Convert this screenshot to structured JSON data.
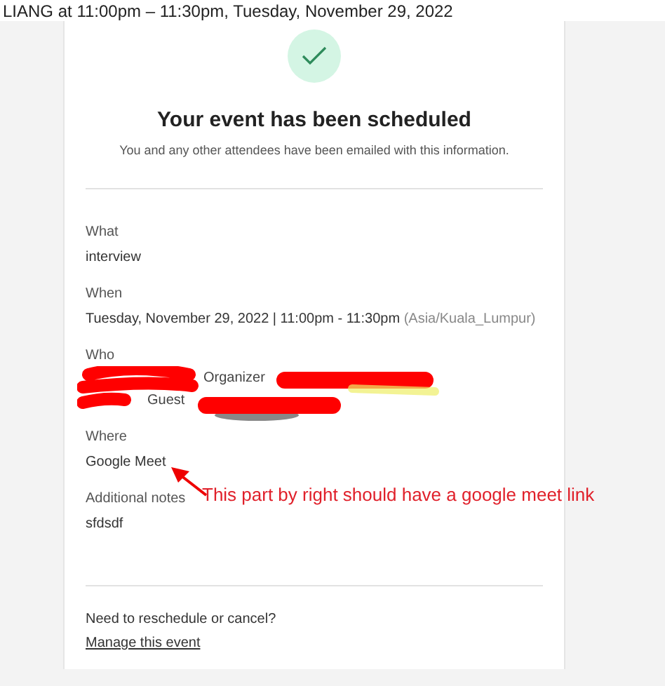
{
  "header": {
    "text": "LIANG at 11:00pm – 11:30pm, Tuesday, November 29, 2022"
  },
  "confirmation": {
    "title": "Your event has been scheduled",
    "subtitle": "You and any other attendees have been emailed with this information."
  },
  "details": [
    {
      "kind": "text",
      "label": "What",
      "value": "interview"
    },
    {
      "kind": "when",
      "label": "When",
      "value": "Tuesday, November 29, 2022 | 11:00pm - 11:30pm",
      "timezone": "(Asia/Kuala_Lumpur)"
    },
    {
      "kind": "who",
      "label": "Who",
      "entries": [
        {
          "role": "Organizer"
        },
        {
          "role": "Guest"
        }
      ]
    },
    {
      "kind": "text",
      "label": "Where",
      "value": "Google Meet"
    },
    {
      "kind": "text",
      "label": "Additional notes",
      "value": "sfdsdf"
    }
  ],
  "footer": {
    "question": "Need to reschedule or cancel?",
    "link": "Manage this event"
  },
  "annotation": {
    "text": "This part by right should have a google meet link"
  }
}
